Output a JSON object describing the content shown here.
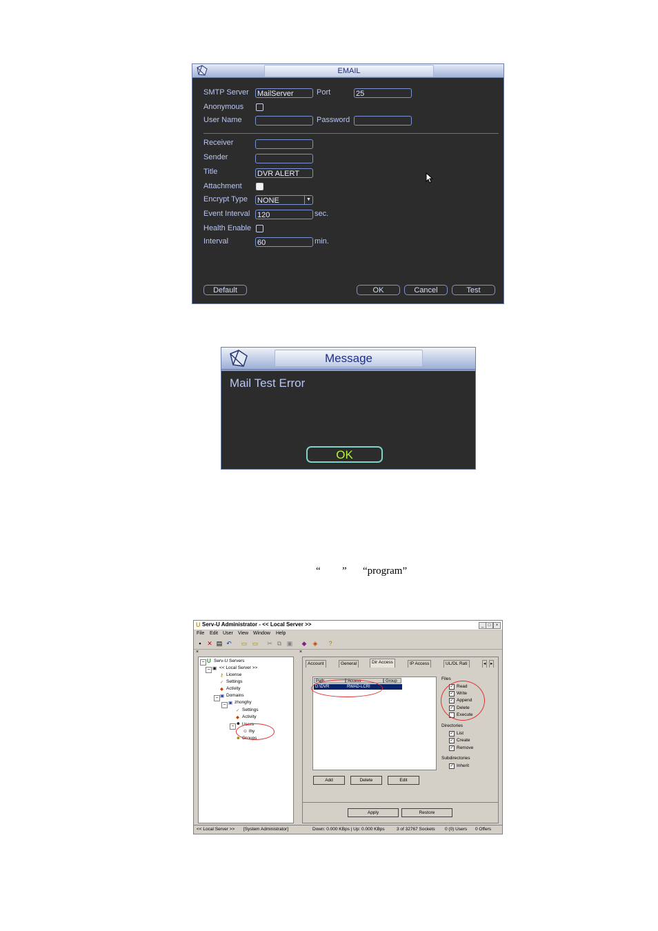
{
  "email_dialog": {
    "title": "EMAIL",
    "smtp_server_label": "SMTP Server",
    "smtp_server_value": "MailServer",
    "port_label": "Port",
    "port_value": "25",
    "anonymous_label": "Anonymous",
    "user_name_label": "User Name",
    "password_label": "Password",
    "receiver_label": "Receiver",
    "sender_label": "Sender",
    "title_label": "Title",
    "title_value": "DVR ALERT",
    "attachment_label": "Attachment",
    "encrypt_type_label": "Encrypt Type",
    "encrypt_type_value": "NONE",
    "event_interval_label": "Event Interval",
    "event_interval_value": "120",
    "event_interval_unit": "sec.",
    "health_enable_label": "Health Enable",
    "interval_label": "Interval",
    "interval_value": "60",
    "interval_unit": "min.",
    "default_button": "Default",
    "ok_button": "OK",
    "cancel_button": "Cancel",
    "test_button": "Test"
  },
  "message_dialog": {
    "title": "Message",
    "text": "Mail Test Error",
    "ok_button": "OK"
  },
  "caption": {
    "open_quote": "“",
    "close_quote": "”",
    "program": "“program”"
  },
  "servu": {
    "title": "Serv-U Administrator - << Local Server >>",
    "menu": [
      "File",
      "Edit",
      "User",
      "View",
      "Window",
      "Help"
    ],
    "tree": {
      "servers": "Serv-U Servers",
      "local_server": "<< Local Server >>",
      "license": "License",
      "settings": "Settings",
      "activity": "Activity",
      "domains": "Domains",
      "domain": "zhonghy",
      "domain_settings": "Settings",
      "domain_activity": "Activity",
      "users": "Users",
      "user": "lhy",
      "groups": "Groups"
    },
    "tabs": [
      "Account",
      "General",
      "Dir Access",
      "IP Access",
      "UL/DL Rati"
    ],
    "columns": [
      "Path",
      "Access",
      "Group"
    ],
    "row": {
      "path": "D:\\DVR",
      "access": "RWAD-LCRI"
    },
    "files_label": "Files",
    "files": [
      "Read",
      "Write",
      "Append",
      "Delete",
      "Execute"
    ],
    "directories_label": "Directories",
    "directories": [
      "List",
      "Create",
      "Remove"
    ],
    "subdirectories_label": "Subdirectories",
    "subdirectories": [
      "Inherit"
    ],
    "add_button": "Add",
    "delete_button": "Delete",
    "edit_button": "Edit",
    "apply_button": "Apply",
    "restore_button": "Restore",
    "status": {
      "server": "<< Local Server >>",
      "role": "[System Administrator]",
      "speed": "Down: 0.000 KBps | Up: 0.000 KBps",
      "sockets": "3 of 32767 Sockets",
      "users": "0 (0) Users",
      "offers": "0 Offers"
    }
  },
  "colors": {
    "dvr_bg": "#2c2c2c",
    "dvr_label": "#b9c6f2",
    "dvr_border": "#7c93d6",
    "ok_text": "#b8f040",
    "annotation_ring": "#e03030"
  }
}
